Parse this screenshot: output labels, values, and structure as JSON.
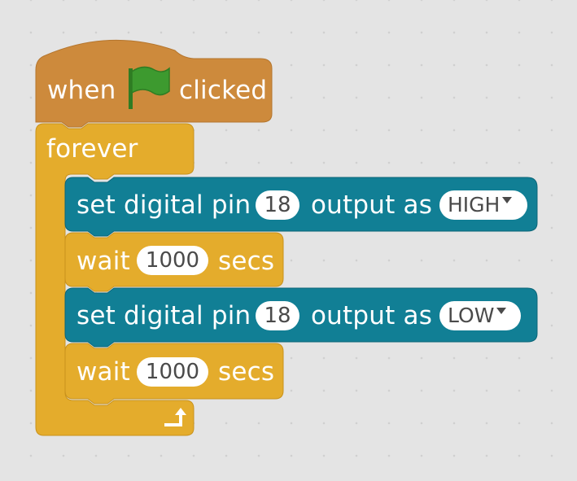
{
  "script": {
    "hat": {
      "when_label": "when",
      "clicked_label": "clicked",
      "icon": "green-flag-icon"
    },
    "forever": {
      "label": "forever",
      "loop_icon": "loop-arrow-icon"
    },
    "blocks": [
      {
        "type": "set-digital-pin",
        "prefix": "set digital pin",
        "pin": "18",
        "middle": "output as",
        "value": "HIGH"
      },
      {
        "type": "wait",
        "prefix": "wait",
        "amount": "1000",
        "suffix": "secs"
      },
      {
        "type": "set-digital-pin",
        "prefix": "set digital pin",
        "pin": "18",
        "middle": "output as",
        "value": "LOW"
      },
      {
        "type": "wait",
        "prefix": "wait",
        "amount": "1000",
        "suffix": "secs"
      }
    ]
  },
  "colors": {
    "hat": "#cd8a3c",
    "control": "#e4ac2c",
    "robot": "#117f95",
    "flag": "#3d9a2f",
    "canvas": "#e4e4e4"
  }
}
